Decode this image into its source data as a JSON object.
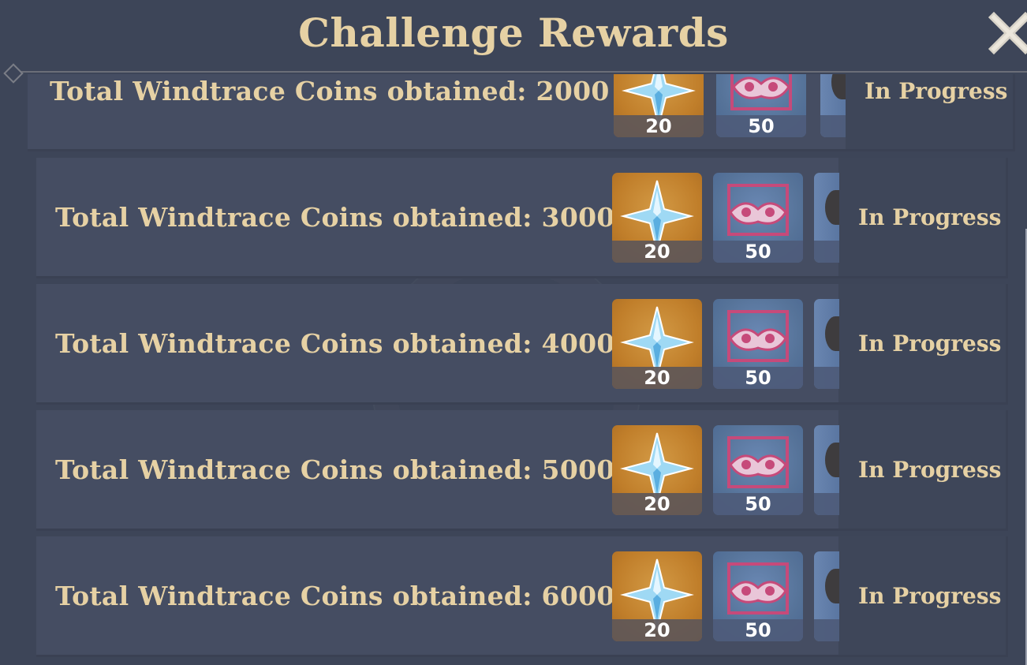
{
  "title": "Challenge Rewards",
  "icons": {
    "close": "close-icon",
    "primogem": "primogem-icon",
    "mask": "mask-icon",
    "partial_item": "item-icon"
  },
  "colors": {
    "background": "#3d4558",
    "row": "#454d62",
    "text_gold": "#e6d1a4",
    "reward_gold": "#c07e2a",
    "reward_blue": "#567399"
  },
  "rewards": [
    {
      "label": "Total Windtrace Coins obtained: 2000",
      "status": "In Progress",
      "items": [
        {
          "icon": "primogem-icon",
          "count": "20"
        },
        {
          "icon": "mask-icon",
          "count": "50"
        }
      ]
    },
    {
      "label": "Total Windtrace Coins obtained: 3000",
      "status": "In Progress",
      "items": [
        {
          "icon": "primogem-icon",
          "count": "20"
        },
        {
          "icon": "mask-icon",
          "count": "50"
        }
      ]
    },
    {
      "label": "Total Windtrace Coins obtained: 4000",
      "status": "In Progress",
      "items": [
        {
          "icon": "primogem-icon",
          "count": "20"
        },
        {
          "icon": "mask-icon",
          "count": "50"
        }
      ]
    },
    {
      "label": "Total Windtrace Coins obtained: 5000",
      "status": "In Progress",
      "items": [
        {
          "icon": "primogem-icon",
          "count": "20"
        },
        {
          "icon": "mask-icon",
          "count": "50"
        }
      ]
    },
    {
      "label": "Total Windtrace Coins obtained: 6000",
      "status": "In Progress",
      "items": [
        {
          "icon": "primogem-icon",
          "count": "20"
        },
        {
          "icon": "mask-icon",
          "count": "50"
        }
      ]
    }
  ]
}
